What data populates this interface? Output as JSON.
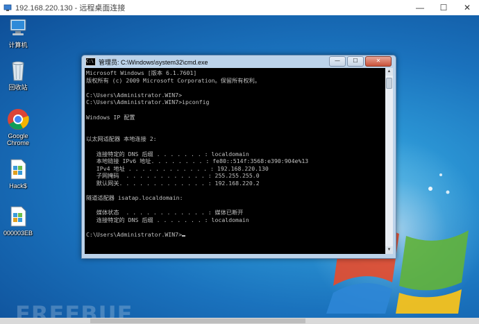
{
  "rdp_window": {
    "title": "192.168.220.130 - 远程桌面连接",
    "controls": {
      "minimize": "—",
      "restore": "☐",
      "close": "✕"
    }
  },
  "desktop_icons": [
    {
      "label": "计算机",
      "icon": "computer-icon"
    },
    {
      "label": "回收站",
      "icon": "recycle-bin-icon"
    },
    {
      "label": "Google\nChrome",
      "icon": "chrome-icon"
    },
    {
      "label": "Hack$",
      "icon": "registry-file-icon"
    },
    {
      "label": "000003EB",
      "icon": "registry-file-icon"
    }
  ],
  "cmd_window": {
    "title": "管理员: C:\\Windows\\system32\\cmd.exe",
    "icon_text": "C:\\",
    "buttons": {
      "minimize": "—",
      "maximize": "☐",
      "close": "✕"
    },
    "console_lines": [
      "Microsoft Windows [版本 6.1.7601]",
      "版权所有 (c) 2009 Microsoft Corporation。保留所有权利。",
      "",
      "C:\\Users\\Administrator.WIN7>",
      "C:\\Users\\Administrator.WIN7>ipconfig",
      "",
      "Windows IP 配置",
      "",
      "",
      "以太网适配器 本地连接 2:",
      "",
      "   连接特定的 DNS 后缀 . . . . . . . : localdomain",
      "   本地链接 IPv6 地址. . . . . . . . : fe80::514f:3568:e390:904e%13",
      "   IPv4 地址 . . . . . . . . . . . . : 192.168.220.130",
      "   子网掩码  . . . . . . . . . . . . : 255.255.255.0",
      "   默认网关. . . . . . . . . . . . . : 192.168.220.2",
      "",
      "隧道适配器 isatap.localdomain:",
      "",
      "   媒体状态  . . . . . . . . . . . . : 媒体已断开",
      "   连接特定的 DNS 后缀 . . . . . . . : localdomain",
      "",
      "C:\\Users\\Administrator.WIN7>"
    ]
  },
  "watermark": "FREEBUF",
  "colors": {
    "console_bg": "#000000",
    "console_text": "#c0c0c0",
    "desktop": "#1a72bd"
  }
}
